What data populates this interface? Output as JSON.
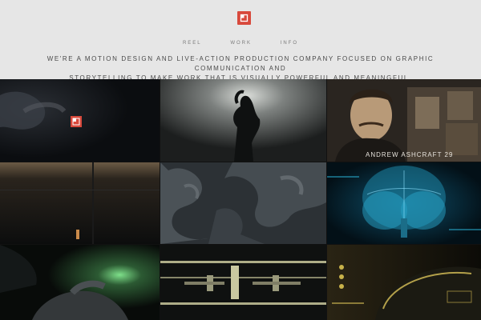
{
  "brand": {
    "accent": "#d8493c",
    "logo_icon": "p-logo-icon"
  },
  "nav": {
    "items": [
      "REEL",
      "WORK",
      "INFO"
    ]
  },
  "tagline": {
    "line1": "WE'RE A MOTION DESIGN AND LIVE-ACTION PRODUCTION COMPANY FOCUSED ON GRAPHIC COMMUNICATION AND",
    "line2": "STORYTELLING TO MAKE WORK THAT IS VISUALLY POWERFUL AND MEANINGFUL."
  },
  "tiles": {
    "t3_caption": "ANDREW ASHCRAFT 29"
  }
}
